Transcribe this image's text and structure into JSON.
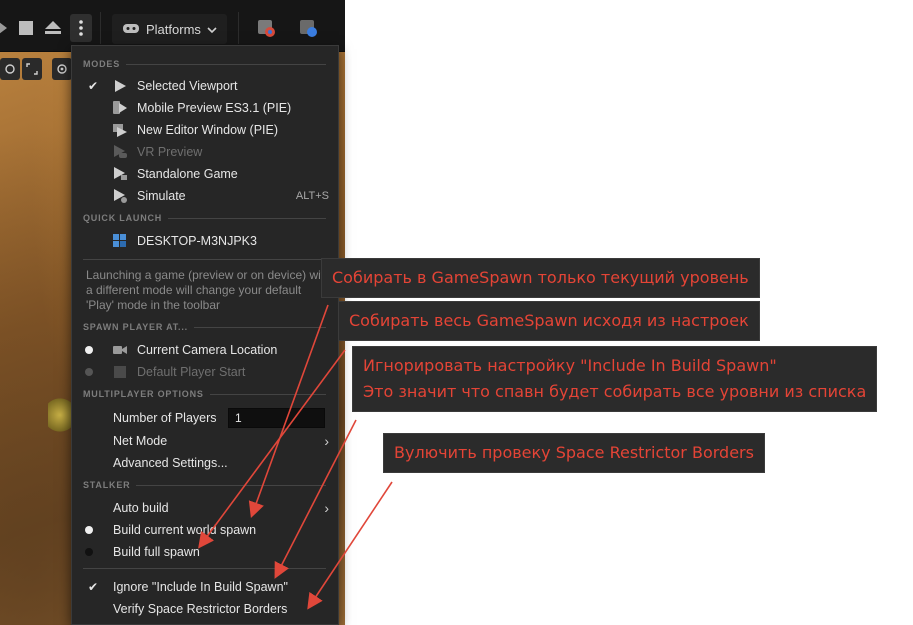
{
  "toolbar": {
    "platforms_label": "Platforms"
  },
  "menu": {
    "modes_header": "MODES",
    "modes": [
      {
        "label": "Selected Viewport",
        "checked": true,
        "icon": "play-icon"
      },
      {
        "label": "Mobile Preview ES3.1 (PIE)",
        "icon": "mobile-preview-icon"
      },
      {
        "label": "New Editor Window (PIE)",
        "icon": "editor-window-icon"
      },
      {
        "label": "VR Preview",
        "disabled": true,
        "icon": "vr-icon"
      },
      {
        "label": "Standalone Game",
        "icon": "standalone-icon"
      },
      {
        "label": "Simulate",
        "shortcut": "ALT+S",
        "icon": "simulate-icon"
      }
    ],
    "quick_launch_header": "QUICK LAUNCH",
    "quick_launch_item": "DESKTOP-M3NJPK3",
    "info_text": "Launching a game (preview or on device) with a different mode will change your default 'Play' mode in the toolbar",
    "spawn_header": "SPAWN PLAYER AT...",
    "spawn_items": [
      {
        "label": "Current Camera Location",
        "selected": true
      },
      {
        "label": "Default Player Start",
        "selected": false,
        "disabled": true
      }
    ],
    "multiplayer_header": "MULTIPLAYER OPTIONS",
    "number_of_players_label": "Number of Players",
    "number_of_players_value": "1",
    "net_mode_label": "Net Mode",
    "advanced_settings_label": "Advanced Settings...",
    "stalker_header": "STALKER",
    "auto_build_label": "Auto build",
    "build_current_label": "Build current world spawn",
    "build_full_label": "Build full spawn",
    "ignore_include_label": "Ignore \"Include In Build Spawn\"",
    "verify_borders_label": "Verify Space Restrictor Borders"
  },
  "annotations": {
    "note1": "Собирать в GameSpawn только текущий уровень",
    "note2": "Собирать весь GameSpawn исходя из настроек",
    "note3_line1": "Игнорировать настройку \"Include In Build Spawn\"",
    "note3_line2": "Это значит что спавн будет собирать все уровни из списка",
    "note4": "Вулючить провеку Space Restrictor Borders"
  },
  "colors": {
    "menu_bg": "#262626",
    "annotation_text": "#e44436",
    "annotation_bg": "#2b2b2b",
    "arrow": "#e0473a"
  }
}
